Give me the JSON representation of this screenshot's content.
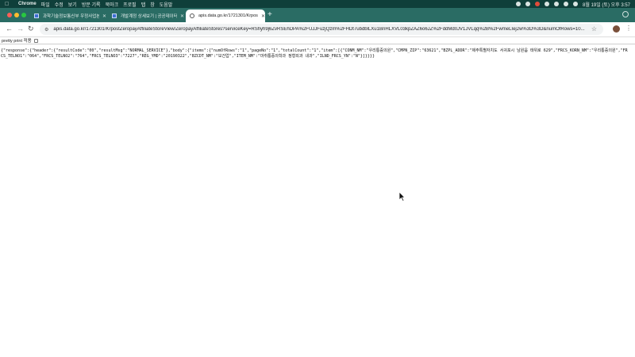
{
  "menubar": {
    "app_name": "Chrome",
    "menus": [
      "파일",
      "수정",
      "보기",
      "방문 기록",
      "북마크",
      "프로필",
      "탭",
      "창",
      "도움말"
    ],
    "clock": "8월 19일 (토) 오후 3:57"
  },
  "tabs": [
    {
      "title": "과학기술정보통신부 우정사업본부",
      "active": false,
      "favicon": "doc-icon"
    },
    {
      "title": "개발계정 상세보기 | 공공데이터포털",
      "active": false,
      "favicon": "doc-icon"
    },
    {
      "title": "apis.data.go.kr/1721301/Krpos",
      "active": true,
      "favicon": "globe-icon"
    }
  ],
  "omnibox": {
    "url": "apis.data.go.kr/1721301/KrpostZeropayAffiliateStoreView/ZeropayAffiliateStores?serviceKey=RShyh9j6ZvRSEhDPA%2FUJJFuzjQzm%2FHDt7ubdblLXu1BnHLXVL03kpZAZ6o6JZ%2FddMd0JV1JVLqq%2B%2FwmeLIej2w%3D%3D&numOfRows=10..."
  },
  "pretty_print": {
    "label": "pretty print 적용",
    "checked": false
  },
  "json_body": "{\"response\":{\"header\":{\"resultCode\":\"00\",\"resultMsg\":\"NORMAL_SERVICE\"},\"body\":{\"items\":{\"numOfRows\":\"1\",\"pageNo\":\"1\",\"totalCount\":\"1\",\"item\":[{\"CONM_NM\":\"우리통증의원\",\"CMPN_ZIP\":\"63621\",\"BZPL_ADDR\":\"제주특별자치도 서귀포시 남원읍 태위로 629\",\"FRCS_KORN_NM\":\"우리통증의원\",\"FRCS_TELNO1\":\"064\",\"FRCS_TELNO2\":\"764\",\"FRCS_TELNO3\":\"7227\",\"REG_YMD\":\"20190322\",\"BZCDT_NM\":\"보건업\",\"ITEM_NM\":\"마취통증의학과 정형외과 내과\",\"ILND_FRCS_YN\":\"N\"}]}}}}"
}
